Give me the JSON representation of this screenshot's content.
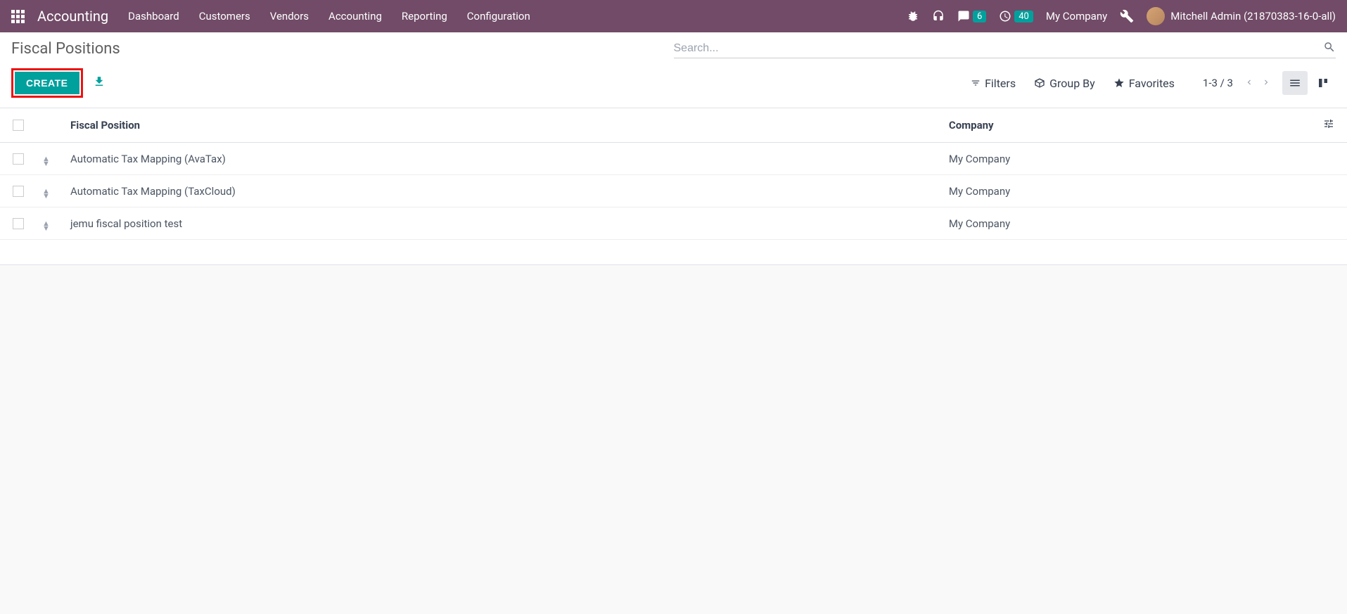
{
  "navbar": {
    "app_name": "Accounting",
    "menu": [
      "Dashboard",
      "Customers",
      "Vendors",
      "Accounting",
      "Reporting",
      "Configuration"
    ],
    "messages_badge": "6",
    "activities_badge": "40",
    "company": "My Company",
    "user": "Mitchell Admin (21870383-16-0-all)"
  },
  "control_panel": {
    "breadcrumb": "Fiscal Positions",
    "search_placeholder": "Search...",
    "create_label": "CREATE",
    "filters_label": "Filters",
    "groupby_label": "Group By",
    "favorites_label": "Favorites",
    "pager": "1-3 / 3"
  },
  "table": {
    "columns": {
      "fiscal_position": "Fiscal Position",
      "company": "Company"
    },
    "rows": [
      {
        "name": "Automatic Tax Mapping (AvaTax)",
        "company": "My Company"
      },
      {
        "name": "Automatic Tax Mapping (TaxCloud)",
        "company": "My Company"
      },
      {
        "name": "jemu fiscal position test",
        "company": "My Company"
      }
    ]
  }
}
